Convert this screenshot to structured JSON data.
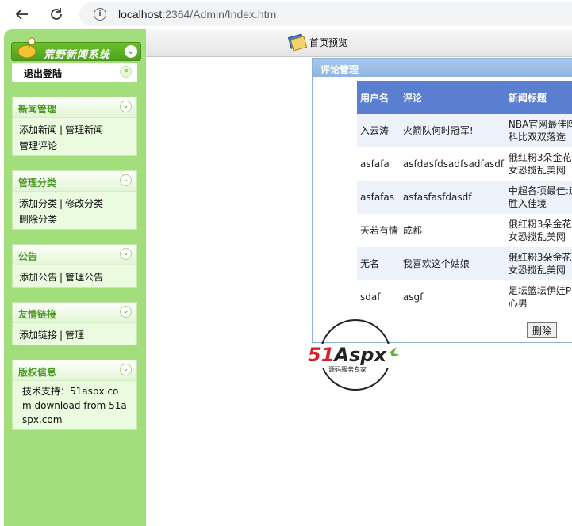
{
  "browser": {
    "url_host": "localhost",
    "url_path": ":2364/Admin/Index.htm"
  },
  "sidebar": {
    "logo_text": "荒野新闻系统",
    "logout_label": "退出登陆",
    "panels": [
      {
        "title": "新闻管理",
        "links": [
          "添加新闻",
          "管理新闻",
          "管理评论"
        ]
      },
      {
        "title": "管理分类",
        "links": [
          "添加分类",
          "修改分类",
          "删除分类"
        ]
      },
      {
        "title": "公告",
        "links": [
          "添加公告",
          "管理公告"
        ]
      },
      {
        "title": "友情链接",
        "links": [
          "添加链接",
          "管理"
        ]
      },
      {
        "title": "版权信息",
        "text": "技术支持：51aspx.com download from 51aspx.com"
      }
    ]
  },
  "topbar": {
    "home_preview_label": "首页预览"
  },
  "comments": {
    "title": "评论管理",
    "columns": [
      "用户名",
      "评论",
      "新闻标题"
    ],
    "rows": [
      {
        "user": "入云涛",
        "comment": "火箭队何时冠军!",
        "news": "NBA官网最佳阵科比双双落选"
      },
      {
        "user": "asfafa",
        "comment": "asfdasfdsadfsadfasdf",
        "news": "俄红粉3朵金花女恐搅乱美网"
      },
      {
        "user": "asfafas",
        "comment": "asfasfasfdasdf",
        "news": "中超各项最佳:连胜入佳境"
      },
      {
        "user": "天若有情",
        "comment": "成都",
        "news": "俄红粉3朵金花女恐搅乱美网"
      },
      {
        "user": "无名",
        "comment": "我喜欢这个姑娘",
        "news": "俄红粉3朵金花女恐搅乱美网"
      },
      {
        "user": "sdaf",
        "comment": "asgf",
        "news": "足坛篮坛伊娃P心男"
      }
    ],
    "delete_label": "删除"
  },
  "watermark": {
    "brand": "51Aspx",
    "tagline": "源码服务专家"
  },
  "colors": {
    "sidebar_green": "#a2df7c",
    "header_blue": "#5a7fd1",
    "panel_title_green": "#4b9a25"
  }
}
